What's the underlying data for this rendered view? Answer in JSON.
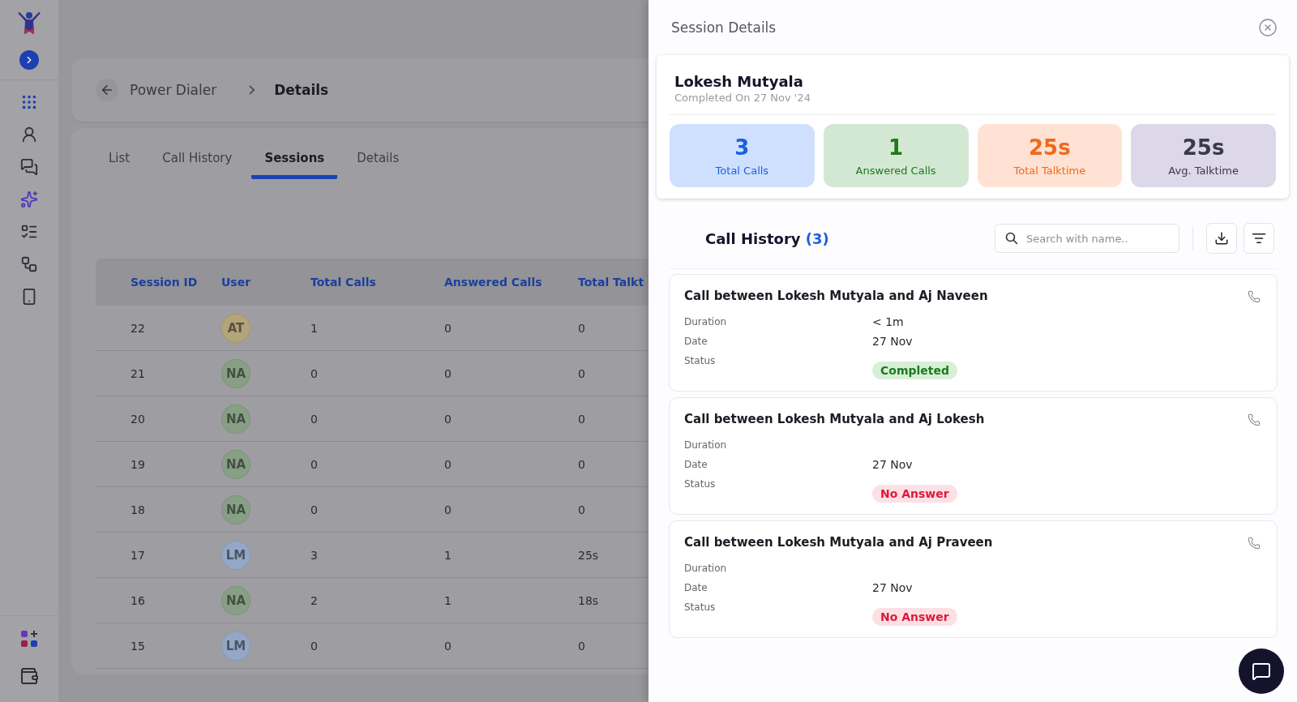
{
  "breadcrumb": {
    "parent": "Power Dialer",
    "current": "Details"
  },
  "tabs": [
    {
      "label": "List",
      "selected": false
    },
    {
      "label": "Call History",
      "selected": false
    },
    {
      "label": "Sessions",
      "selected": true
    },
    {
      "label": "Details",
      "selected": false
    }
  ],
  "table": {
    "columns": [
      "Session ID",
      "User",
      "Total Calls",
      "Answered Calls",
      "Total Talkt"
    ],
    "rows": [
      {
        "session_id": "22",
        "user": {
          "initials": "AT",
          "color": "#b3a57a"
        },
        "total_calls": "1",
        "answered_calls": "0",
        "talktime": "0"
      },
      {
        "session_id": "21",
        "user": {
          "initials": "NA",
          "color": "#87a085"
        },
        "total_calls": "0",
        "answered_calls": "0",
        "talktime": "0"
      },
      {
        "session_id": "20",
        "user": {
          "initials": "NA",
          "color": "#87a085"
        },
        "total_calls": "0",
        "answered_calls": "0",
        "talktime": "0"
      },
      {
        "session_id": "19",
        "user": {
          "initials": "NA",
          "color": "#87a085"
        },
        "total_calls": "0",
        "answered_calls": "0",
        "talktime": "0"
      },
      {
        "session_id": "18",
        "user": {
          "initials": "NA",
          "color": "#87a085"
        },
        "total_calls": "0",
        "answered_calls": "0",
        "talktime": "0"
      },
      {
        "session_id": "17",
        "user": {
          "initials": "LM",
          "color": "#93a8c6"
        },
        "total_calls": "3",
        "answered_calls": "1",
        "talktime": "25s"
      },
      {
        "session_id": "16",
        "user": {
          "initials": "NA",
          "color": "#87a085"
        },
        "total_calls": "2",
        "answered_calls": "1",
        "talktime": "18s"
      },
      {
        "session_id": "15",
        "user": {
          "initials": "LM",
          "color": "#93a8c6"
        },
        "total_calls": "0",
        "answered_calls": "0",
        "talktime": "0"
      }
    ]
  },
  "drawer": {
    "title": "Session Details",
    "user": {
      "name": "Lokesh Mutyala",
      "completed": "Completed On 27 Nov '24"
    },
    "stats": [
      {
        "value": "3",
        "label": "Total Calls",
        "kind": "calls"
      },
      {
        "value": "1",
        "label": "Answered Calls",
        "kind": "answered"
      },
      {
        "value": "25s",
        "label": "Total Talktime",
        "kind": "talktime"
      },
      {
        "value": "25s",
        "label": "Avg. Talktime",
        "kind": "average"
      }
    ],
    "call_history": {
      "title": "Call History",
      "count": "(3)",
      "search": {
        "placeholder": "Search with name.."
      },
      "calls": [
        {
          "title": "Call between Lokesh Mutyala and Aj Naveen",
          "fields": [
            {
              "label": "Duration",
              "value": "< 1m"
            },
            {
              "label": "Date",
              "value": "27 Nov"
            },
            {
              "label": "Status",
              "status": "Completed",
              "kind": "success"
            }
          ]
        },
        {
          "title": "Call between Lokesh Mutyala and Aj Lokesh",
          "fields": [
            {
              "label": "Duration"
            },
            {
              "label": "Date",
              "value": "27 Nov"
            },
            {
              "label": "Status",
              "status": "No Answer",
              "kind": "missed"
            }
          ]
        },
        {
          "title": "Call between Lokesh Mutyala and Aj Praveen",
          "fields": [
            {
              "label": "Duration"
            },
            {
              "label": "Date",
              "value": "27 Nov"
            },
            {
              "label": "Status",
              "status": "No Answer",
              "kind": "missed"
            }
          ]
        }
      ]
    }
  }
}
